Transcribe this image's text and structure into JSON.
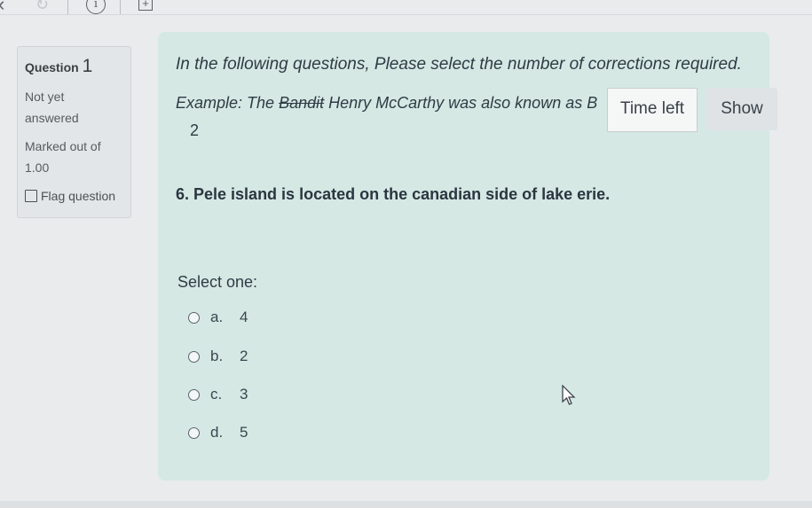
{
  "toolbar": {
    "back_icon": "chevron-left-icon",
    "reload_icon": "reload-icon",
    "info_icon": "info-icon",
    "info_glyph": "i",
    "add_icon": "plus-box-icon",
    "add_glyph": "+"
  },
  "info": {
    "question_label": "Question",
    "question_number": "1",
    "status_line1": "Not yet",
    "status_line2": "answered",
    "marked_line1": "Marked out of",
    "marked_line2": "1.00",
    "flag_label": "Flag question"
  },
  "content": {
    "instruction": "In the following questions, Please select the number of corrections required.",
    "example_prefix": "Example:  The ",
    "example_struck": "Bandit",
    "example_suffix": " Henry McCarthy was also known as B",
    "example_answer": "2",
    "question": "6. Pele island is located on the canadian side of lake erie.",
    "select_label": "Select one:",
    "options": [
      {
        "letter": "a.",
        "value": "4"
      },
      {
        "letter": "b.",
        "value": "2"
      },
      {
        "letter": "c.",
        "value": "3"
      },
      {
        "letter": "d.",
        "value": "5"
      }
    ]
  },
  "timer": {
    "label": "Time left",
    "show_label": "Show"
  },
  "colors": {
    "panel_bg": "#d5e8e4",
    "page_bg": "#e9ebec"
  }
}
